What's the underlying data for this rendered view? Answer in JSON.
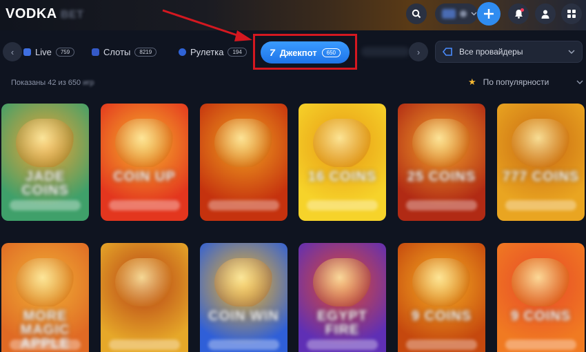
{
  "header": {
    "logo_text": "VODKA",
    "logo_suffix": "BET",
    "icons": [
      "search-icon",
      "plus-icon",
      "bell-icon",
      "user-icon",
      "grid-icon"
    ]
  },
  "nav": {
    "prev_label": "‹",
    "next_label": "›",
    "tabs": [
      {
        "label": "Live",
        "count": "759"
      },
      {
        "label": "Слоты",
        "count": "8219"
      },
      {
        "label": "Рулетка",
        "count": "194"
      }
    ],
    "active_tab": {
      "label": "Джекпот",
      "count": "650",
      "icon": "7"
    },
    "providers_label": "Все провайдеры"
  },
  "filter": {
    "shown_text": "Показаны 42 из 650",
    "shown_suffix": "игр",
    "sort_label": "По популярности"
  },
  "games": [
    {
      "title": "JADE COINS",
      "colors": [
        "#3fa06a",
        "#f0a334"
      ]
    },
    {
      "title": "COIN UP",
      "colors": [
        "#e3361e",
        "#f6b12c"
      ]
    },
    {
      "title": "",
      "colors": [
        "#c5320e",
        "#f0a020"
      ]
    },
    {
      "title": "16 COINS",
      "colors": [
        "#f6d32a",
        "#e89a14"
      ]
    },
    {
      "title": "25 COINS",
      "colors": [
        "#b12a14",
        "#f1a12a"
      ]
    },
    {
      "title": "777 COINS",
      "colors": [
        "#e9a521",
        "#c96a12"
      ]
    },
    {
      "title": "MORE MAGIC APPLE",
      "colors": [
        "#e06a24",
        "#f0b036"
      ]
    },
    {
      "title": "",
      "colors": [
        "#e6a829",
        "#b64015"
      ]
    },
    {
      "title": "COIN WIN",
      "colors": [
        "#2f5fd8",
        "#f1b526"
      ]
    },
    {
      "title": "EGYPT FIRE",
      "colors": [
        "#5f2fb5",
        "#e04a30"
      ]
    },
    {
      "title": "9 COINS",
      "colors": [
        "#c5480e",
        "#f5ac22"
      ]
    },
    {
      "title": "9 COINS",
      "colors": [
        "#f07a22",
        "#e84a28"
      ]
    }
  ],
  "colors": {
    "accent": "#2f8cf0",
    "highlight_box": "#d41820",
    "arrow": "#d41820"
  }
}
